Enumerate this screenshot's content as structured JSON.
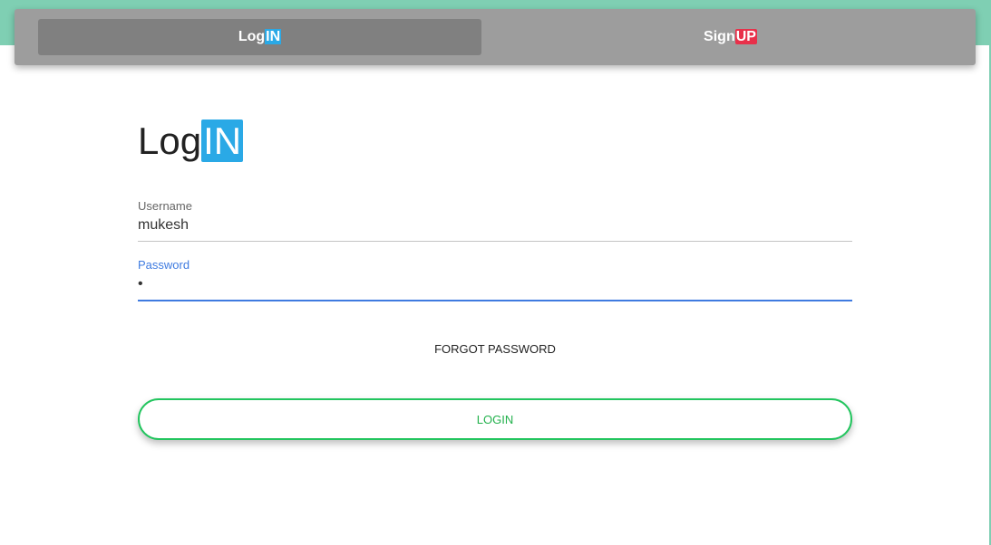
{
  "tabs": {
    "login": {
      "prefix": "Log",
      "highlight": "IN"
    },
    "signup": {
      "prefix": "Sign",
      "highlight": "UP"
    }
  },
  "form": {
    "title_prefix": "Log",
    "title_highlight": "IN",
    "username": {
      "label": "Username",
      "value": "mukesh"
    },
    "password": {
      "label": "Password",
      "value": "•"
    },
    "forgot_label": "FORGOT PASSWORD",
    "submit_label": "LOGIN"
  },
  "colors": {
    "accent_blue": "#2aa9e6",
    "accent_red": "#e8304a",
    "submit_green": "#22c55e",
    "focus_blue": "#3f7be0",
    "background_teal": "#7fcfb3"
  }
}
